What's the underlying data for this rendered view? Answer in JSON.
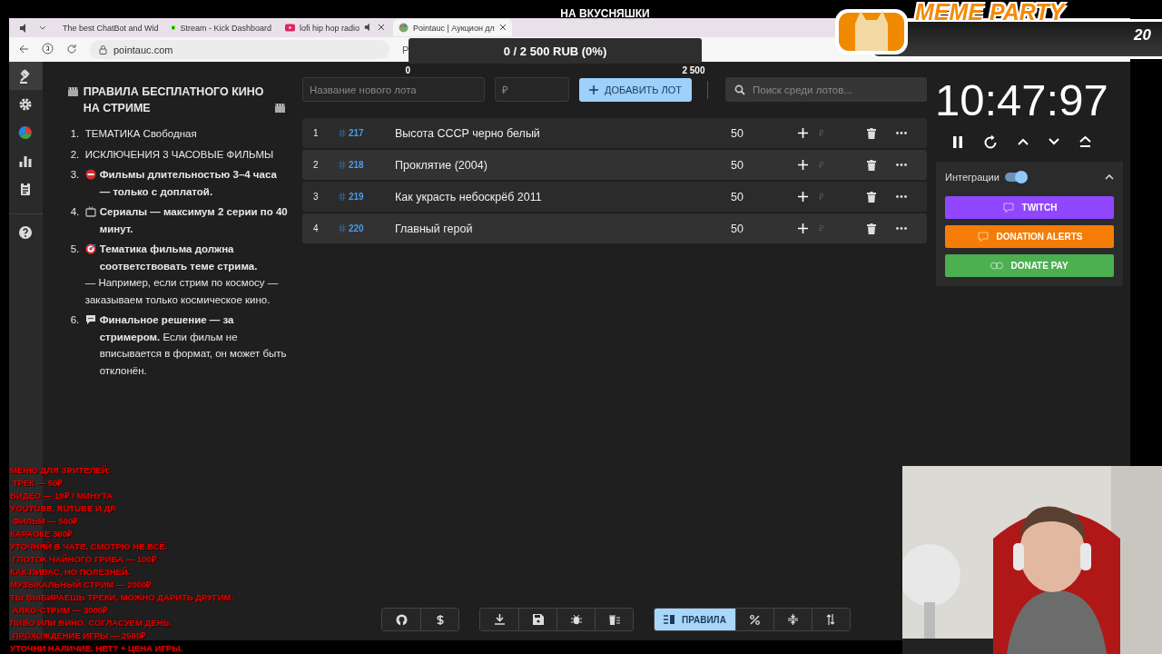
{
  "browser": {
    "muted": true,
    "tabs": [
      {
        "title": "The best ChatBot and Wid",
        "selected": false
      },
      {
        "title": "Stream - Kick Dashboard",
        "selected": false
      },
      {
        "title": "lofi hip hop radio",
        "selected": false
      },
      {
        "title": "Pointauc | Аукцион дл",
        "selected": true
      }
    ],
    "address": "pointauc.com",
    "address_extra": "Р"
  },
  "sidebar": {
    "items": [
      {
        "selected": true
      },
      {
        "selected": false
      },
      {
        "selected": false
      },
      {
        "selected": false
      },
      {
        "selected": false
      },
      {
        "selected": false
      }
    ]
  },
  "rules": {
    "title": "ПРАВИЛА БЕСПЛАТНОГО КИНО НА СТРИМЕ",
    "items": [
      {
        "number": "1.",
        "text": "ТЕМАТИКА Свободная"
      },
      {
        "number": "2.",
        "text": "ИСКЛЮЧЕНИЯ  3 ЧАСОВЫЕ ФИЛЬМЫ"
      },
      {
        "number": "3.",
        "text": "**Фильмы длительностью 3–4 часа — только с доплатой.**"
      },
      {
        "number": "4.",
        "text": "**Сериалы — максимум 2 серии по 40 минут.**"
      },
      {
        "number": "5.",
        "text": "**Тематика фильма должна соответствовать теме стрима.**",
        "note": "— Например, если стрим по космосу — заказываем только космическое кино."
      },
      {
        "number": "6.",
        "text": "**Финальное решение — за стримером.** Если фильм не вписывается в формат, он может быть отклонён."
      }
    ]
  },
  "lot_form": {
    "name_placeholder": "Название нового лота",
    "amount_placeholder": "₽",
    "add_label": "ДОБАВИТЬ ЛОТ",
    "search_placeholder": "Поиск среди лотов..."
  },
  "lots": [
    {
      "index": "1",
      "id": "217",
      "name": "Высота СССР черно белый",
      "amount": "50",
      "placeholder": "₽"
    },
    {
      "index": "2",
      "id": "218",
      "name": "Проклятие (2004)",
      "amount": "50",
      "placeholder": "₽"
    },
    {
      "index": "3",
      "id": "219",
      "name": "Как украсть небоскрёб 2011",
      "amount": "50",
      "placeholder": "₽"
    },
    {
      "index": "4",
      "id": "220",
      "name": "Главный герой",
      "amount": "50",
      "placeholder": "₽"
    }
  ],
  "timer": {
    "time": "10:47:97"
  },
  "integrations": {
    "title": "Интеграции",
    "enabled": true,
    "expanded": true,
    "buttons": [
      {
        "label": "TWITCH",
        "color": "#9146ff"
      },
      {
        "label": "DONATION ALERTS",
        "color": "#f57d07"
      },
      {
        "label": "DONATE PAY",
        "color": "#4caf50"
      }
    ]
  },
  "toolbar": {
    "rules_button": {
      "label": "ПРАВИЛА",
      "selected": true
    }
  },
  "overlays": {
    "goal": {
      "title": "НА ВКУСНЯШКИ",
      "progress": "0 / 2 500 RUB (0%)",
      "level": 0,
      "min": "0",
      "max": "2 500"
    },
    "badge": {
      "title": "MEME PARTY",
      "count": "20"
    },
    "menu": {
      "lines": [
        "МЕНЮ ДЛЯ ЗРИТЕЛЕЙ:",
        " ТРЕК — 50₽",
        "ВИДЕО — 10₽ / МИНУТА",
        "YOUTUBE, RUTUBE И ДР.",
        " ФИЛЬМ — 500₽",
        "КАРАОКЕ 300₽",
        "УТОЧНЯЙ В ЧАТЕ, СМОТРЮ НЕ ВСЁ.",
        " ГЛОТОК ЧАЙНОГО ГРИБА — 100₽",
        "КАК ПИВАС, НО ПОЛЕЗНЕЙ.",
        "МУЗЫКАЛЬНЫЙ СТРИМ — 2000₽",
        "ТЫ ВЫБИРАЕШЬ ТРЕКИ, МОЖНО ДАРИТЬ ДРУГИМ.",
        " АЛКО-СТРИМ — 3000₽",
        "ПИВО ИЛИ ВИНО. СОГЛАСУЕМ ДЕНЬ.",
        " ПРОХОЖДЕНИЕ ИГРЫ — 2500₽",
        "УТОЧНИ НАЛИЧИЕ. НЕТ? + ЦЕНА ИГРЫ."
      ]
    }
  }
}
